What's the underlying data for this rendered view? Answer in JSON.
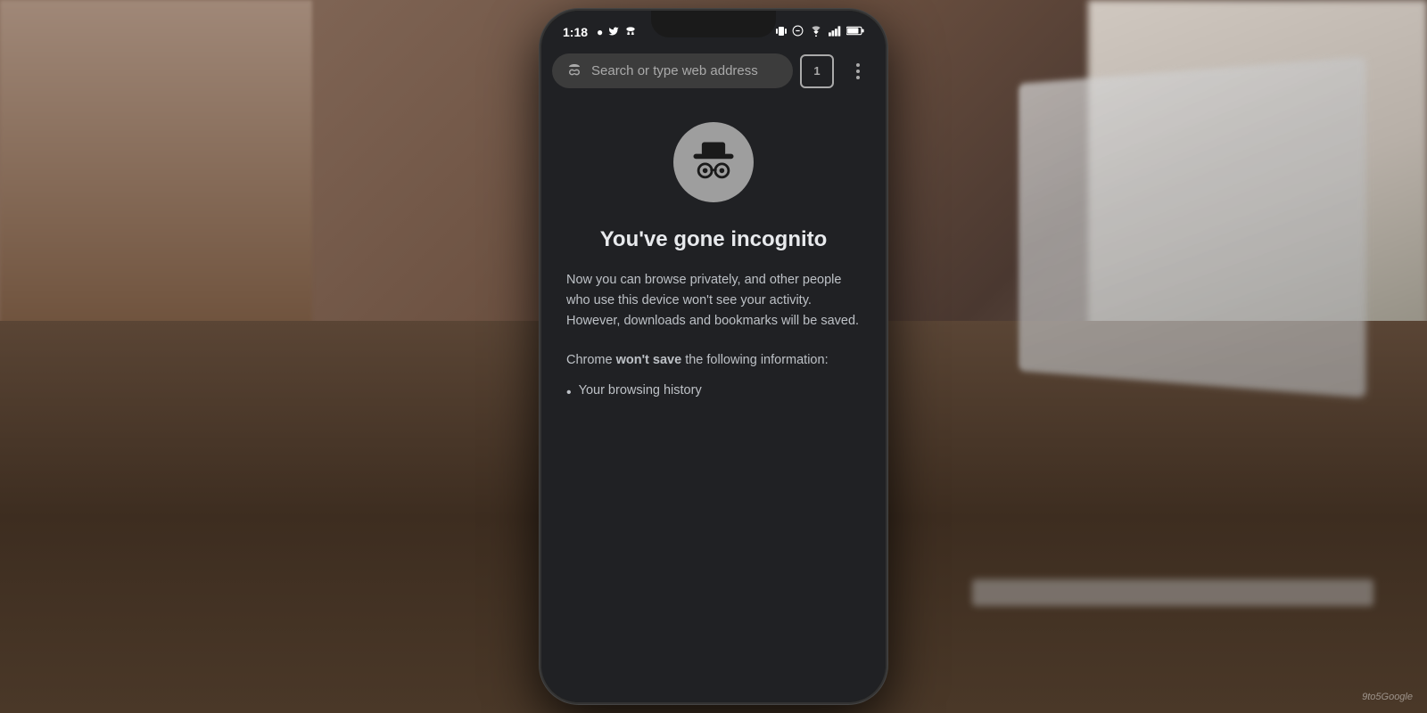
{
  "scene": {
    "watermark": "9to5Google"
  },
  "statusBar": {
    "time": "1:18",
    "leftIcons": [
      "spotify-icon",
      "twitter-icon",
      "incognito-status-icon"
    ],
    "rightIcons": [
      "vibrate-icon",
      "dnd-icon",
      "wifi-icon",
      "signal-icon",
      "battery-icon"
    ]
  },
  "browser": {
    "addressBar": {
      "placeholder": "Search or type web address",
      "incognitoIconLabel": "🕵"
    },
    "tabCount": "1",
    "tabCountLabel": "1",
    "moreMenuLabel": "⋮"
  },
  "incognitoPage": {
    "iconAlt": "Incognito icon",
    "title": "You've gone incognito",
    "description": "Now you can browse privately, and other people who use this device won't see your activity. However, downloads and bookmarks will be saved.",
    "saveInfo": "Chrome",
    "saveInfoBold": "won't save",
    "saveInfoRest": " the following information:",
    "listItems": [
      "Your browsing history"
    ]
  }
}
